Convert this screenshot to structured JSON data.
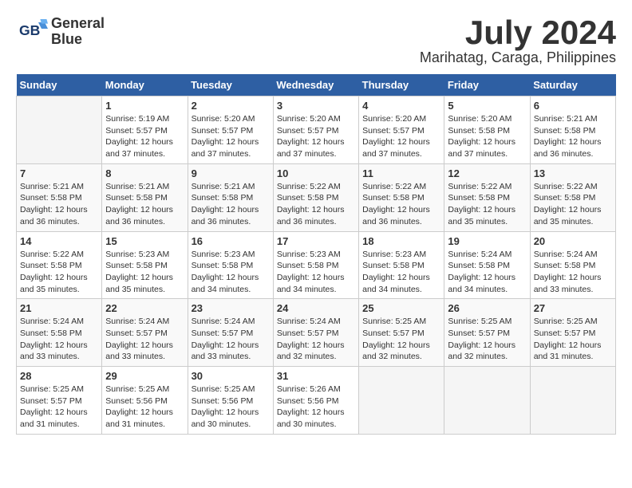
{
  "logo": {
    "line1": "General",
    "line2": "Blue"
  },
  "title": "July 2024",
  "location": "Marihatag, Caraga, Philippines",
  "days_of_week": [
    "Sunday",
    "Monday",
    "Tuesday",
    "Wednesday",
    "Thursday",
    "Friday",
    "Saturday"
  ],
  "weeks": [
    [
      {
        "day": "",
        "detail": ""
      },
      {
        "day": "1",
        "detail": "Sunrise: 5:19 AM\nSunset: 5:57 PM\nDaylight: 12 hours\nand 37 minutes."
      },
      {
        "day": "2",
        "detail": "Sunrise: 5:20 AM\nSunset: 5:57 PM\nDaylight: 12 hours\nand 37 minutes."
      },
      {
        "day": "3",
        "detail": "Sunrise: 5:20 AM\nSunset: 5:57 PM\nDaylight: 12 hours\nand 37 minutes."
      },
      {
        "day": "4",
        "detail": "Sunrise: 5:20 AM\nSunset: 5:57 PM\nDaylight: 12 hours\nand 37 minutes."
      },
      {
        "day": "5",
        "detail": "Sunrise: 5:20 AM\nSunset: 5:58 PM\nDaylight: 12 hours\nand 37 minutes."
      },
      {
        "day": "6",
        "detail": "Sunrise: 5:21 AM\nSunset: 5:58 PM\nDaylight: 12 hours\nand 36 minutes."
      }
    ],
    [
      {
        "day": "7",
        "detail": "Sunrise: 5:21 AM\nSunset: 5:58 PM\nDaylight: 12 hours\nand 36 minutes."
      },
      {
        "day": "8",
        "detail": "Sunrise: 5:21 AM\nSunset: 5:58 PM\nDaylight: 12 hours\nand 36 minutes."
      },
      {
        "day": "9",
        "detail": "Sunrise: 5:21 AM\nSunset: 5:58 PM\nDaylight: 12 hours\nand 36 minutes."
      },
      {
        "day": "10",
        "detail": "Sunrise: 5:22 AM\nSunset: 5:58 PM\nDaylight: 12 hours\nand 36 minutes."
      },
      {
        "day": "11",
        "detail": "Sunrise: 5:22 AM\nSunset: 5:58 PM\nDaylight: 12 hours\nand 36 minutes."
      },
      {
        "day": "12",
        "detail": "Sunrise: 5:22 AM\nSunset: 5:58 PM\nDaylight: 12 hours\nand 35 minutes."
      },
      {
        "day": "13",
        "detail": "Sunrise: 5:22 AM\nSunset: 5:58 PM\nDaylight: 12 hours\nand 35 minutes."
      }
    ],
    [
      {
        "day": "14",
        "detail": "Sunrise: 5:22 AM\nSunset: 5:58 PM\nDaylight: 12 hours\nand 35 minutes."
      },
      {
        "day": "15",
        "detail": "Sunrise: 5:23 AM\nSunset: 5:58 PM\nDaylight: 12 hours\nand 35 minutes."
      },
      {
        "day": "16",
        "detail": "Sunrise: 5:23 AM\nSunset: 5:58 PM\nDaylight: 12 hours\nand 34 minutes."
      },
      {
        "day": "17",
        "detail": "Sunrise: 5:23 AM\nSunset: 5:58 PM\nDaylight: 12 hours\nand 34 minutes."
      },
      {
        "day": "18",
        "detail": "Sunrise: 5:23 AM\nSunset: 5:58 PM\nDaylight: 12 hours\nand 34 minutes."
      },
      {
        "day": "19",
        "detail": "Sunrise: 5:24 AM\nSunset: 5:58 PM\nDaylight: 12 hours\nand 34 minutes."
      },
      {
        "day": "20",
        "detail": "Sunrise: 5:24 AM\nSunset: 5:58 PM\nDaylight: 12 hours\nand 33 minutes."
      }
    ],
    [
      {
        "day": "21",
        "detail": "Sunrise: 5:24 AM\nSunset: 5:58 PM\nDaylight: 12 hours\nand 33 minutes."
      },
      {
        "day": "22",
        "detail": "Sunrise: 5:24 AM\nSunset: 5:57 PM\nDaylight: 12 hours\nand 33 minutes."
      },
      {
        "day": "23",
        "detail": "Sunrise: 5:24 AM\nSunset: 5:57 PM\nDaylight: 12 hours\nand 33 minutes."
      },
      {
        "day": "24",
        "detail": "Sunrise: 5:24 AM\nSunset: 5:57 PM\nDaylight: 12 hours\nand 32 minutes."
      },
      {
        "day": "25",
        "detail": "Sunrise: 5:25 AM\nSunset: 5:57 PM\nDaylight: 12 hours\nand 32 minutes."
      },
      {
        "day": "26",
        "detail": "Sunrise: 5:25 AM\nSunset: 5:57 PM\nDaylight: 12 hours\nand 32 minutes."
      },
      {
        "day": "27",
        "detail": "Sunrise: 5:25 AM\nSunset: 5:57 PM\nDaylight: 12 hours\nand 31 minutes."
      }
    ],
    [
      {
        "day": "28",
        "detail": "Sunrise: 5:25 AM\nSunset: 5:57 PM\nDaylight: 12 hours\nand 31 minutes."
      },
      {
        "day": "29",
        "detail": "Sunrise: 5:25 AM\nSunset: 5:56 PM\nDaylight: 12 hours\nand 31 minutes."
      },
      {
        "day": "30",
        "detail": "Sunrise: 5:25 AM\nSunset: 5:56 PM\nDaylight: 12 hours\nand 30 minutes."
      },
      {
        "day": "31",
        "detail": "Sunrise: 5:26 AM\nSunset: 5:56 PM\nDaylight: 12 hours\nand 30 minutes."
      },
      {
        "day": "",
        "detail": ""
      },
      {
        "day": "",
        "detail": ""
      },
      {
        "day": "",
        "detail": ""
      }
    ]
  ]
}
